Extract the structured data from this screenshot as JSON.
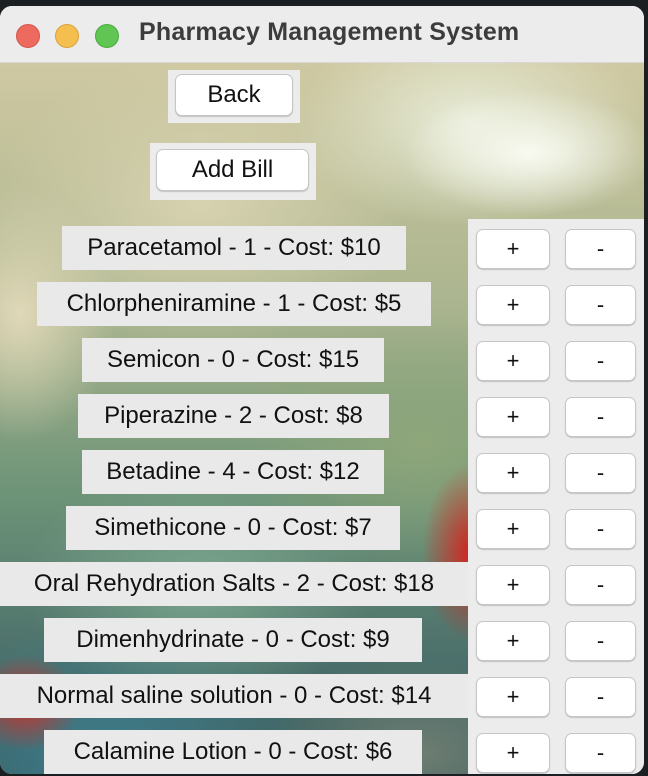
{
  "window": {
    "title": "Pharmacy Management System"
  },
  "actions": {
    "back_label": "Back",
    "add_bill_label": "Add Bill"
  },
  "controls": {
    "plus": "+",
    "minus": "-"
  },
  "items": [
    {
      "text": "Paracetamol - 1 - Cost: $10"
    },
    {
      "text": "Chlorpheniramine - 1 - Cost: $5"
    },
    {
      "text": "Semicon - 0 - Cost: $15"
    },
    {
      "text": "Piperazine - 2 - Cost: $8"
    },
    {
      "text": "Betadine - 4 - Cost: $12"
    },
    {
      "text": "Simethicone - 0 - Cost: $7"
    },
    {
      "text": "Oral Rehydration Salts - 2 - Cost: $18"
    },
    {
      "text": "Dimenhydrinate - 0 - Cost: $9"
    },
    {
      "text": "Normal saline solution - 0 - Cost: $14"
    },
    {
      "text": "Calamine Lotion - 0 - Cost: $6"
    }
  ]
}
